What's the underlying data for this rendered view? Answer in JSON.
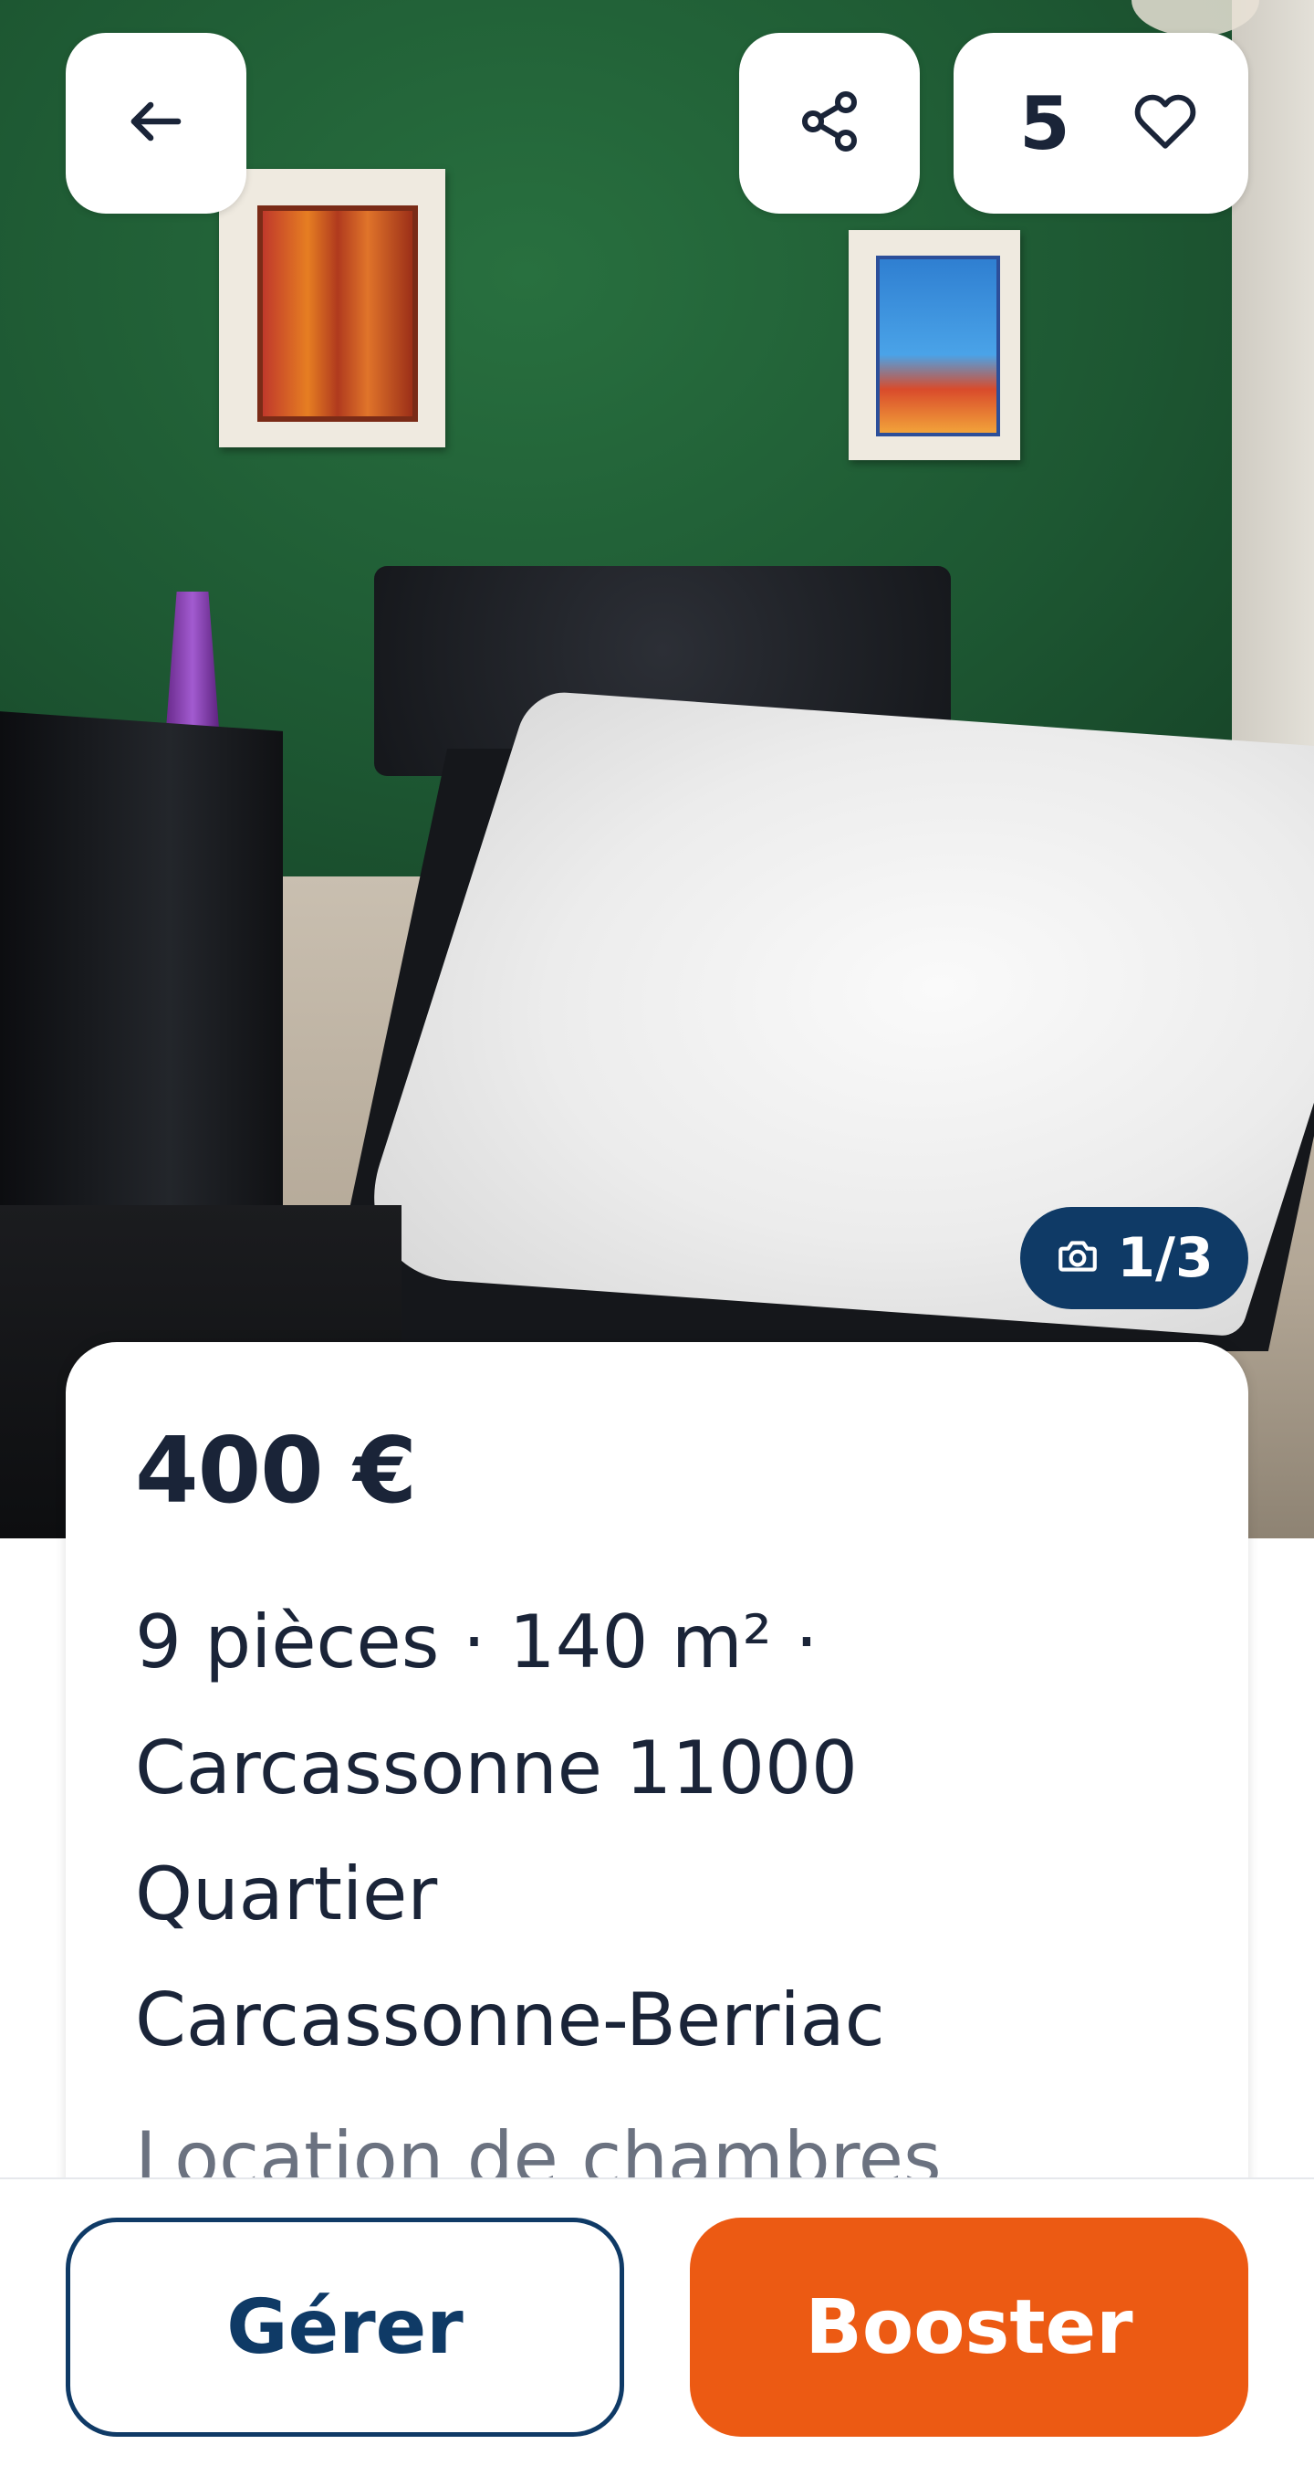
{
  "listing": {
    "photo_alt": "Chambre avec lit double",
    "favorites_count": "5",
    "photo_counter": "1/3",
    "price": "400 €",
    "summary_lines": [
      "9 pièces · 140 m² ·",
      "Carcassonne 11000",
      "Quartier",
      "Carcassonne-Berriac"
    ],
    "description_preview": "Location de chambres"
  },
  "actions": {
    "manage_label": "Gérer",
    "boost_label": "Booster"
  },
  "icons": {
    "back": "arrow-left-icon",
    "share": "share-icon",
    "favorite": "heart-icon",
    "camera": "camera-icon"
  },
  "colors": {
    "primary": "#0f3a66",
    "accent": "#ec5a13",
    "text": "#1a2438"
  }
}
